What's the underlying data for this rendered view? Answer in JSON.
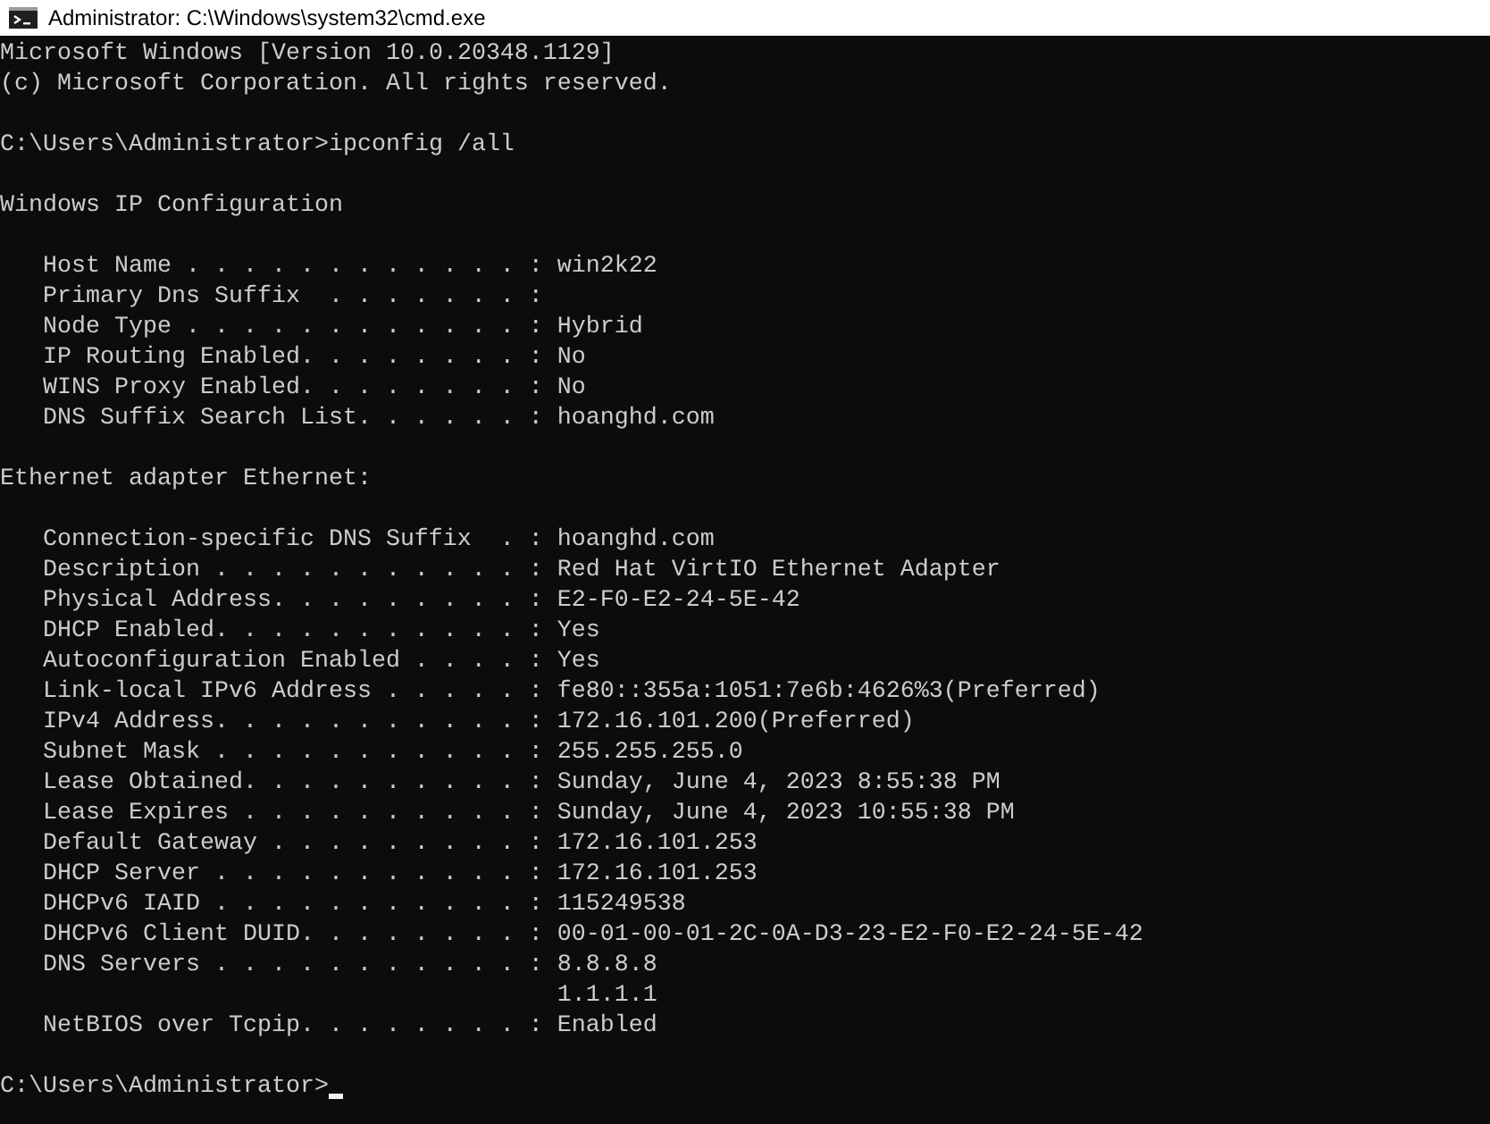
{
  "window": {
    "title": "Administrator: C:\\Windows\\system32\\cmd.exe"
  },
  "console": {
    "blocks": [
      {
        "kind": "text",
        "lines": [
          "Microsoft Windows [Version 10.0.20348.1129]",
          "(c) Microsoft Corporation. All rights reserved."
        ]
      },
      {
        "kind": "text",
        "lines": [
          "C:\\Users\\Administrator>ipconfig /all"
        ]
      },
      {
        "kind": "text",
        "lines": [
          "Windows IP Configuration"
        ]
      },
      {
        "kind": "entries",
        "entries": [
          {
            "label": "Host Name . . . . . . . . . . . . :",
            "values": [
              "win2k22"
            ]
          },
          {
            "label": "Primary Dns Suffix  . . . . . . . :"
          },
          {
            "label": "Node Type . . . . . . . . . . . . :",
            "values": [
              "Hybrid"
            ]
          },
          {
            "label": "IP Routing Enabled. . . . . . . . :",
            "values": [
              "No"
            ]
          },
          {
            "label": "WINS Proxy Enabled. . . . . . . . :",
            "values": [
              "No"
            ]
          },
          {
            "label": "DNS Suffix Search List. . . . . . :",
            "values": [
              "hoanghd.com"
            ]
          }
        ]
      },
      {
        "kind": "text",
        "lines": [
          "Ethernet adapter Ethernet:"
        ]
      },
      {
        "kind": "entries",
        "entries": [
          {
            "label": "Connection-specific DNS Suffix  . :",
            "values": [
              "hoanghd.com"
            ]
          },
          {
            "label": "Description . . . . . . . . . . . :",
            "values": [
              "Red Hat VirtIO Ethernet Adapter"
            ]
          },
          {
            "label": "Physical Address. . . . . . . . . :",
            "values": [
              "E2-F0-E2-24-5E-42"
            ]
          },
          {
            "label": "DHCP Enabled. . . . . . . . . . . :",
            "values": [
              "Yes"
            ]
          },
          {
            "label": "Autoconfiguration Enabled . . . . :",
            "values": [
              "Yes"
            ]
          },
          {
            "label": "Link-local IPv6 Address . . . . . :",
            "values": [
              "fe80::355a:1051:7e6b:4626%3(Preferred)"
            ]
          },
          {
            "label": "IPv4 Address. . . . . . . . . . . :",
            "values": [
              "172.16.101.200(Preferred)"
            ]
          },
          {
            "label": "Subnet Mask . . . . . . . . . . . :",
            "values": [
              "255.255.255.0"
            ]
          },
          {
            "label": "Lease Obtained. . . . . . . . . . :",
            "values": [
              "Sunday, June 4, 2023 8:55:38 PM"
            ]
          },
          {
            "label": "Lease Expires . . . . . . . . . . :",
            "values": [
              "Sunday, June 4, 2023 10:55:38 PM"
            ]
          },
          {
            "label": "Default Gateway . . . . . . . . . :",
            "values": [
              "172.16.101.253"
            ]
          },
          {
            "label": "DHCP Server . . . . . . . . . . . :",
            "values": [
              "172.16.101.253"
            ]
          },
          {
            "label": "DHCPv6 IAID . . . . . . . . . . . :",
            "values": [
              "115249538"
            ]
          },
          {
            "label": "DHCPv6 Client DUID. . . . . . . . :",
            "values": [
              "00-01-00-01-2C-0A-D3-23-E2-F0-E2-24-5E-42"
            ]
          },
          {
            "label": "DNS Servers . . . . . . . . . . . :",
            "values": [
              "8.8.8.8",
              "1.1.1.1"
            ]
          },
          {
            "label": "NetBIOS over Tcpip. . . . . . . . :",
            "values": [
              "Enabled"
            ]
          }
        ]
      },
      {
        "kind": "prompt",
        "prompt": "C:\\Users\\Administrator>"
      }
    ]
  }
}
